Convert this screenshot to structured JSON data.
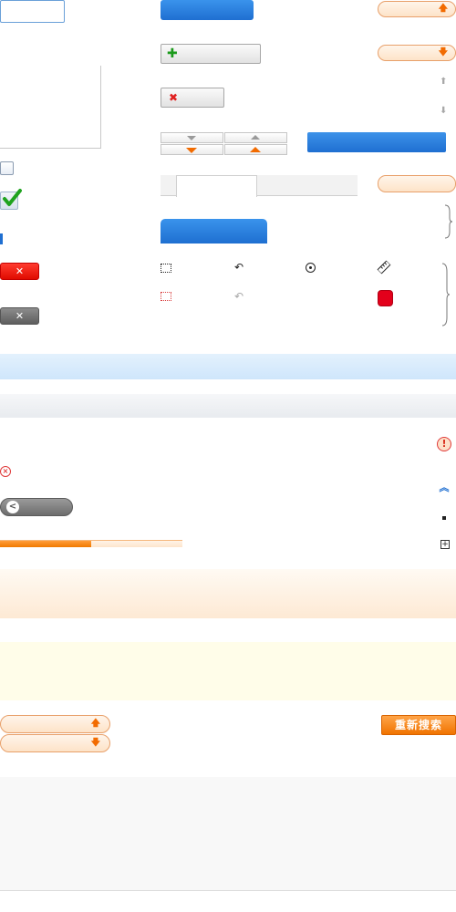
{
  "buttons": {
    "research_label": "重新搜索",
    "close_label": "✕",
    "add_glyph": "✚",
    "remove_glyph": "✖",
    "back_glyph": "<"
  },
  "icons": {
    "arrow_up": "🡅",
    "arrow_down": "🡇",
    "arrow_up_small": "⬆",
    "arrow_down_small": "⬇",
    "undo": "↶",
    "ruler": "📏",
    "double_chevron_up": "︽",
    "plus": "+",
    "warning": "!",
    "error": "×"
  },
  "progress": {
    "fraction": 0.5
  },
  "colors": {
    "accent_blue": "#1f6fd1",
    "accent_orange": "#f07300",
    "error_red": "#e3001b"
  }
}
